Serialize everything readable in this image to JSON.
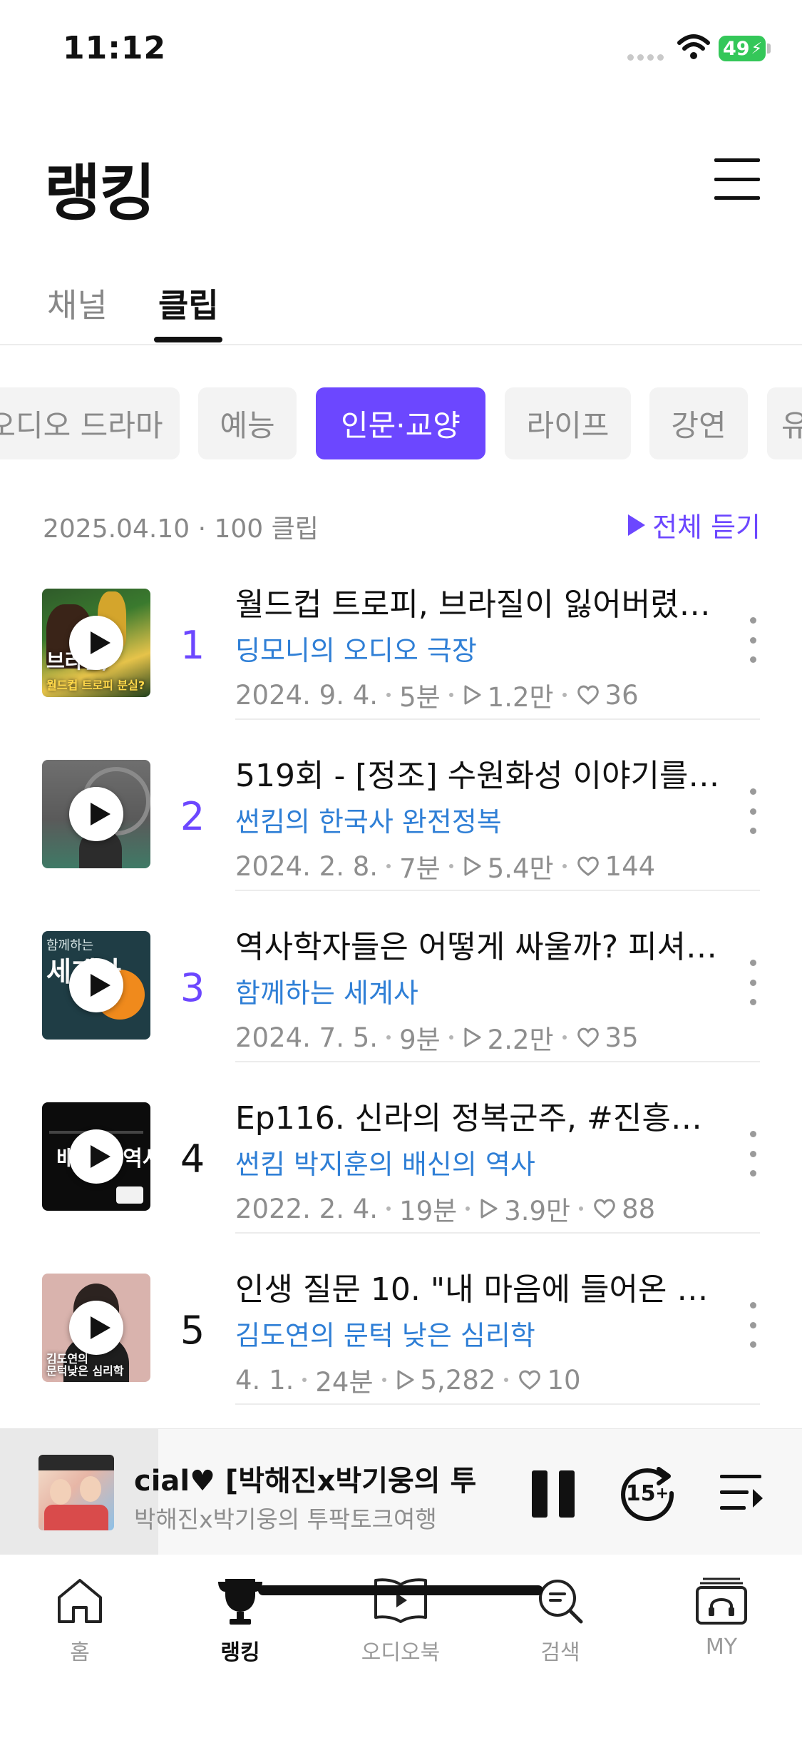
{
  "status_bar": {
    "time": "11:12",
    "battery": "49"
  },
  "header": {
    "title": "랭킹"
  },
  "tabs": [
    {
      "label": "채널",
      "active": false
    },
    {
      "label": "클립",
      "active": true
    }
  ],
  "categories": [
    "오디오 드라마",
    "예능",
    "인문·교양",
    "라이프",
    "강연",
    "유"
  ],
  "categories_active": "인문·교양",
  "info": {
    "date_count": "2025.04.10 · 100 클립",
    "play_all": "전체 듣기"
  },
  "items": [
    {
      "rank": "1",
      "title": "월드컵 트로피, 브라질이 잃어버렸다...",
      "channel": "딩모니의 오디오 극장",
      "date": "2024. 9. 4.",
      "duration": "5분",
      "plays": "1.2만",
      "likes": "36",
      "thumb_text": "브라질,",
      "thumb_sub": "월드컵 트로피 분실?"
    },
    {
      "rank": "2",
      "title": "519회 - [정조] 수원화성 이야기를…",
      "channel": "썬킴의 한국사 완전정복",
      "date": "2024. 2. 8.",
      "duration": "7분",
      "plays": "5.4만",
      "likes": "144",
      "thumb_text": "",
      "thumb_sub": ""
    },
    {
      "rank": "3",
      "title": "역사학자들은 어떻게 싸울까? 피셔…",
      "channel": "함께하는 세계사",
      "date": "2024. 7. 5.",
      "duration": "9분",
      "plays": "2.2만",
      "likes": "35",
      "thumb_text": "함께하는",
      "thumb_sub": "세계사"
    },
    {
      "rank": "4",
      "title": "Ep116. 신라의 정복군주, #진흥왕…",
      "channel": "썬킴 박지훈의 배신의 역사",
      "date": "2022. 2. 4.",
      "duration": "19분",
      "plays": "3.9만",
      "likes": "88",
      "thumb_text": "배신의 역사",
      "thumb_sub": ""
    },
    {
      "rank": "5",
      "title": "인생 질문 10. \"내 마음에 들어온 책…",
      "channel": "김도연의 문턱 낮은 심리학",
      "date": "4. 1.",
      "duration": "24분",
      "plays": "5,282",
      "likes": "10",
      "thumb_text": "김도연의",
      "thumb_sub": "문턱낮은 심리학"
    }
  ],
  "player": {
    "title": "cial♥          [박해진x박기웅의 투",
    "subtitle": "박해진x박기웅의 투팍토크여행",
    "skip_label": "15"
  },
  "nav": [
    {
      "label": "홈",
      "active": false
    },
    {
      "label": "랭킹",
      "active": true
    },
    {
      "label": "오디오북",
      "active": false
    },
    {
      "label": "검색",
      "active": false
    },
    {
      "label": "MY",
      "active": false
    }
  ],
  "colors": {
    "accent": "#6c47ff",
    "channel_link": "#2f7fd6",
    "battery": "#34c759"
  }
}
